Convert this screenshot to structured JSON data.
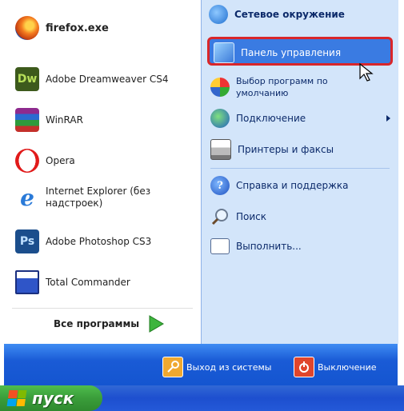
{
  "pinned": [
    {
      "label": "firefox.exe",
      "icon": "firefox-icon"
    },
    {
      "label": "Adobe Dreamweaver CS4",
      "icon": "dreamweaver-icon",
      "glyph": "Dw"
    },
    {
      "label": "WinRAR",
      "icon": "winrar-icon"
    },
    {
      "label": "Opera",
      "icon": "opera-icon"
    },
    {
      "label": "Internet Explorer (без надстроек)",
      "line1": "Internet Explorer (без",
      "line2": "надстроек)",
      "icon": "internet-explorer-icon"
    },
    {
      "label": "Adobe Photoshop CS3",
      "icon": "photoshop-icon",
      "glyph": "Ps"
    },
    {
      "label": "Total Commander",
      "icon": "total-commander-icon"
    }
  ],
  "all_programs": "Все программы",
  "right": {
    "network": "Сетевое окружение",
    "control_panel": "Панель управления",
    "default_programs_1": "Выбор программ по",
    "default_programs_2": "умолчанию",
    "connect": "Подключение",
    "printers": "Принтеры и факсы",
    "help": "Справка и поддержка",
    "search": "Поиск",
    "run": "Выполнить..."
  },
  "bottom": {
    "logoff": "Выход из системы",
    "shutdown": "Выключение"
  },
  "taskbar": {
    "start": "пуск"
  },
  "colors": {
    "highlight_border": "#d9262a",
    "right_panel": "#d3e5fa",
    "start_green": "#3a9d3a"
  }
}
